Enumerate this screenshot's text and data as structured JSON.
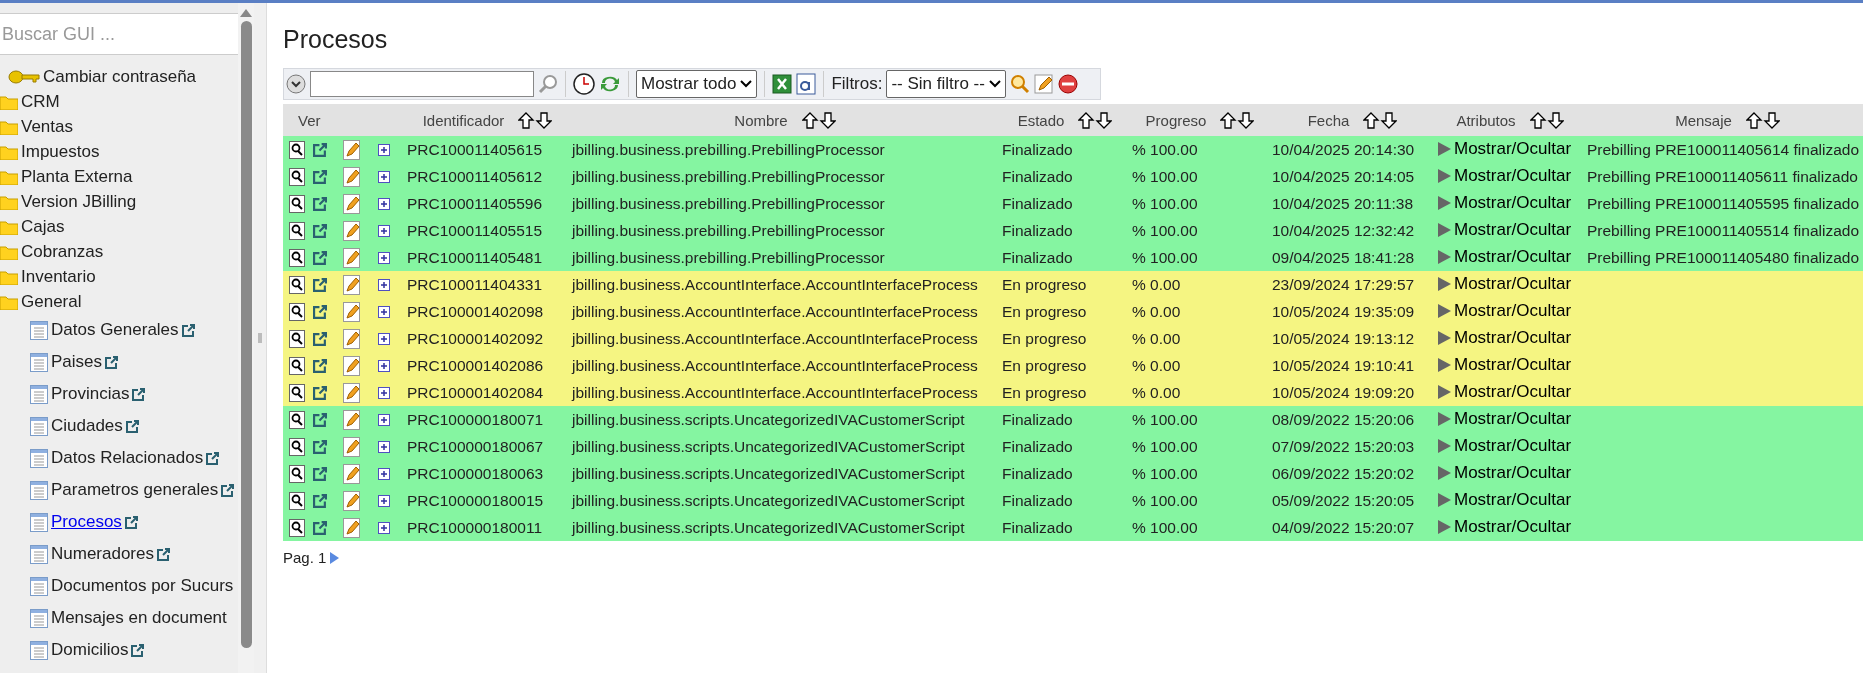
{
  "sidebar": {
    "search": {
      "placeholder": "Buscar GUI ..."
    },
    "items": [
      {
        "kind": "key",
        "label": "Cambiar contraseña",
        "selected": false
      },
      {
        "kind": "folder",
        "label": "CRM",
        "selected": false
      },
      {
        "kind": "folder",
        "label": "Ventas",
        "selected": false
      },
      {
        "kind": "folder",
        "label": "Impuestos",
        "selected": false
      },
      {
        "kind": "folder",
        "label": "Planta Externa",
        "selected": false
      },
      {
        "kind": "folder",
        "label": "Version JBilling",
        "selected": false
      },
      {
        "kind": "folder",
        "label": "Cajas",
        "selected": false
      },
      {
        "kind": "folder",
        "label": "Cobranzas",
        "selected": false
      },
      {
        "kind": "folder",
        "label": "Inventario",
        "selected": false
      },
      {
        "kind": "folder",
        "label": "General",
        "selected": false,
        "children": [
          {
            "kind": "page",
            "label": "Datos Generales",
            "selected": false,
            "external": true
          },
          {
            "kind": "page",
            "label": "Paises",
            "selected": false,
            "external": true
          },
          {
            "kind": "page",
            "label": "Provincias",
            "selected": false,
            "external": true
          },
          {
            "kind": "page",
            "label": "Ciudades",
            "selected": false,
            "external": true
          },
          {
            "kind": "page",
            "label": "Datos Relacionados",
            "selected": false,
            "external": true
          },
          {
            "kind": "page",
            "label": "Parametros generales",
            "selected": false,
            "external": true
          },
          {
            "kind": "page",
            "label": "Procesos",
            "selected": true,
            "external": true
          },
          {
            "kind": "page",
            "label": "Numeradores",
            "selected": false,
            "external": true
          },
          {
            "kind": "page",
            "label": "Documentos por Sucurs",
            "selected": false,
            "external": false
          },
          {
            "kind": "page",
            "label": "Mensajes en document",
            "selected": false,
            "external": false
          },
          {
            "kind": "page",
            "label": "Domicilios",
            "selected": false,
            "external": true
          }
        ]
      }
    ]
  },
  "page": {
    "title": "Procesos"
  },
  "toolbar": {
    "view_select": "Mostrar todo",
    "filters_label": "Filtros:",
    "filter_select": "-- Sin filtro --"
  },
  "table": {
    "columns": [
      "Ver",
      "Identificador",
      "Nombre",
      "Estado",
      "Progreso",
      "Fecha",
      "Atributos",
      "Mensaje"
    ],
    "rows": [
      {
        "color": "#85f5a1",
        "id": "PRC100011405615",
        "name": "jbilling.business.prebilling.PrebillingProcessor",
        "status": "Finalizado",
        "progress": "% 100.00",
        "date": "10/04/2025 20:14:30",
        "attributes": "Mostrar/Ocultar",
        "message": "Prebilling PRE100011405614 finalizado"
      },
      {
        "color": "#85f5a1",
        "id": "PRC100011405612",
        "name": "jbilling.business.prebilling.PrebillingProcessor",
        "status": "Finalizado",
        "progress": "% 100.00",
        "date": "10/04/2025 20:14:05",
        "attributes": "Mostrar/Ocultar",
        "message": "Prebilling PRE100011405611 finalizado"
      },
      {
        "color": "#85f5a1",
        "id": "PRC100011405596",
        "name": "jbilling.business.prebilling.PrebillingProcessor",
        "status": "Finalizado",
        "progress": "% 100.00",
        "date": "10/04/2025 20:11:38",
        "attributes": "Mostrar/Ocultar",
        "message": "Prebilling PRE100011405595 finalizado"
      },
      {
        "color": "#85f5a1",
        "id": "PRC100011405515",
        "name": "jbilling.business.prebilling.PrebillingProcessor",
        "status": "Finalizado",
        "progress": "% 100.00",
        "date": "10/04/2025 12:32:42",
        "attributes": "Mostrar/Ocultar",
        "message": "Prebilling PRE100011405514 finalizado"
      },
      {
        "color": "#85f5a1",
        "id": "PRC100011405481",
        "name": "jbilling.business.prebilling.PrebillingProcessor",
        "status": "Finalizado",
        "progress": "% 100.00",
        "date": "09/04/2025 18:41:28",
        "attributes": "Mostrar/Ocultar",
        "message": "Prebilling PRE100011405480 finalizado"
      },
      {
        "color": "#f5f582",
        "id": "PRC100011404331",
        "name": "jbilling.business.AccountInterface.AccountInterfaceProcess",
        "status": "En progreso",
        "progress": "% 0.00",
        "date": "23/09/2024 17:29:57",
        "attributes": "Mostrar/Ocultar"
      },
      {
        "color": "#f5f582",
        "id": "PRC100001402098",
        "name": "jbilling.business.AccountInterface.AccountInterfaceProcess",
        "status": "En progreso",
        "progress": "% 0.00",
        "date": "10/05/2024 19:35:09",
        "attributes": "Mostrar/Ocultar"
      },
      {
        "color": "#f5f582",
        "id": "PRC100001402092",
        "name": "jbilling.business.AccountInterface.AccountInterfaceProcess",
        "status": "En progreso",
        "progress": "% 0.00",
        "date": "10/05/2024 19:13:12",
        "attributes": "Mostrar/Ocultar"
      },
      {
        "color": "#f5f582",
        "id": "PRC100001402086",
        "name": "jbilling.business.AccountInterface.AccountInterfaceProcess",
        "status": "En progreso",
        "progress": "% 0.00",
        "date": "10/05/2024 19:10:41",
        "attributes": "Mostrar/Ocultar"
      },
      {
        "color": "#f5f582",
        "id": "PRC100001402084",
        "name": "jbilling.business.AccountInterface.AccountInterfaceProcess",
        "status": "En progreso",
        "progress": "% 0.00",
        "date": "10/05/2024 19:09:20",
        "attributes": "Mostrar/Ocultar"
      },
      {
        "color": "#85f5a1",
        "id": "PRC100000180071",
        "name": "jbilling.business.scripts.UncategorizedIVACustomerScript",
        "status": "Finalizado",
        "progress": "% 100.00",
        "date": "08/09/2022 15:20:06",
        "attributes": "Mostrar/Ocultar"
      },
      {
        "color": "#85f5a1",
        "id": "PRC100000180067",
        "name": "jbilling.business.scripts.UncategorizedIVACustomerScript",
        "status": "Finalizado",
        "progress": "% 100.00",
        "date": "07/09/2022 15:20:03",
        "attributes": "Mostrar/Ocultar"
      },
      {
        "color": "#85f5a1",
        "id": "PRC100000180063",
        "name": "jbilling.business.scripts.UncategorizedIVACustomerScript",
        "status": "Finalizado",
        "progress": "% 100.00",
        "date": "06/09/2022 15:20:02",
        "attributes": "Mostrar/Ocultar"
      },
      {
        "color": "#85f5a1",
        "id": "PRC100000180015",
        "name": "jbilling.business.scripts.UncategorizedIVACustomerScript",
        "status": "Finalizado",
        "progress": "% 100.00",
        "date": "05/09/2022 15:20:05",
        "attributes": "Mostrar/Ocultar"
      },
      {
        "color": "#85f5a1",
        "id": "PRC100000180011",
        "name": "jbilling.business.scripts.UncategorizedIVACustomerScript",
        "status": "Finalizado",
        "progress": "% 100.00",
        "date": "04/09/2022 15:20:07",
        "attributes": "Mostrar/Ocultar"
      }
    ]
  },
  "pagination": {
    "label": "Pag. 1"
  }
}
